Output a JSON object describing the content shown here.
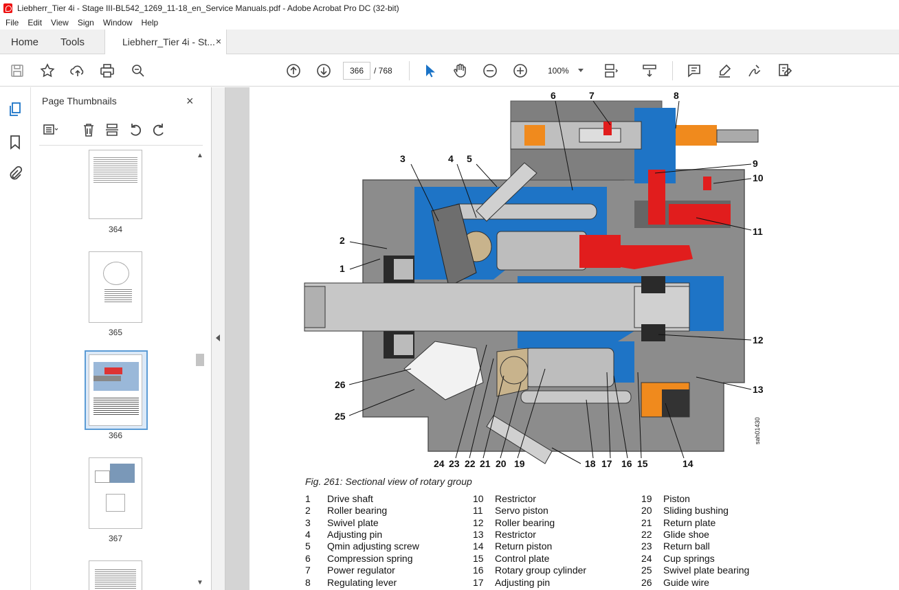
{
  "window": {
    "title": "Liebherr_Tier 4i - Stage III-BL542_1269_11-18_en_Service Manuals.pdf - Adobe Acrobat Pro DC (32-bit)"
  },
  "menu": [
    "File",
    "Edit",
    "View",
    "Sign",
    "Window",
    "Help"
  ],
  "tabs": {
    "home": "Home",
    "tools": "Tools",
    "document": "Liebherr_Tier 4i - St...",
    "close": "×"
  },
  "toolbar": {
    "current_page": "366",
    "total_pages": "/ 768",
    "zoom": "100%"
  },
  "thumbnails": {
    "title": "Page Thumbnails",
    "close": "×",
    "pages": [
      "364",
      "365",
      "366",
      "367"
    ],
    "selected_page": "366"
  },
  "figure": {
    "caption": "Fig. 261: Sectional view of rotary group",
    "side_code": "sah01430",
    "callouts": [
      "1",
      "2",
      "3",
      "4",
      "5",
      "6",
      "7",
      "8",
      "9",
      "10",
      "11",
      "12",
      "13",
      "14",
      "15",
      "16",
      "17",
      "18",
      "19",
      "20",
      "21",
      "22",
      "23",
      "24",
      "25",
      "26"
    ],
    "legend": [
      {
        "n": "1",
        "t": "Drive shaft"
      },
      {
        "n": "2",
        "t": "Roller bearing"
      },
      {
        "n": "3",
        "t": "Swivel plate"
      },
      {
        "n": "4",
        "t": "Adjusting pin"
      },
      {
        "n": "5",
        "t": "Qmin adjusting screw"
      },
      {
        "n": "6",
        "t": "Compression spring"
      },
      {
        "n": "7",
        "t": "Power regulator"
      },
      {
        "n": "8",
        "t": "Regulating lever"
      },
      {
        "n": "10",
        "t": "Restrictor"
      },
      {
        "n": "11",
        "t": "Servo piston"
      },
      {
        "n": "12",
        "t": "Roller bearing"
      },
      {
        "n": "13",
        "t": "Restrictor"
      },
      {
        "n": "14",
        "t": "Return piston"
      },
      {
        "n": "15",
        "t": "Control plate"
      },
      {
        "n": "16",
        "t": "Rotary group cylinder"
      },
      {
        "n": "17",
        "t": "Adjusting pin"
      },
      {
        "n": "19",
        "t": "Piston"
      },
      {
        "n": "20",
        "t": "Sliding bushing"
      },
      {
        "n": "21",
        "t": "Return plate"
      },
      {
        "n": "22",
        "t": "Glide shoe"
      },
      {
        "n": "23",
        "t": "Return ball"
      },
      {
        "n": "24",
        "t": "Cup springs"
      },
      {
        "n": "25",
        "t": "Swivel plate bearing"
      },
      {
        "n": "26",
        "t": "Guide wire"
      }
    ]
  },
  "icons": [
    "save-icon",
    "star-icon",
    "upload-icon",
    "print-icon",
    "zoom-search-icon",
    "page-up-icon",
    "page-down-icon",
    "select-cursor-icon",
    "hand-icon",
    "zoom-out-icon",
    "zoom-in-icon",
    "fit-page-icon",
    "scroll-mode-icon",
    "comment-icon",
    "highlight-icon",
    "sign-icon",
    "edit-pdf-icon"
  ],
  "colors": {
    "accent": "#1a73c7",
    "selection": "#5b9bd5",
    "pump_blue": "#1e74c6",
    "pump_red": "#e11d1d",
    "pump_orange": "#f08a1d"
  }
}
